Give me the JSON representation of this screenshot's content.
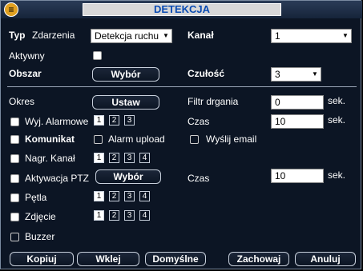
{
  "window": {
    "title": "DETEKCJA"
  },
  "labels": {
    "typ": "Typ",
    "zdarzenia": "Zdarzenia",
    "kanal": "Kanał",
    "aktywny": "Aktywny",
    "obszar": "Obszar",
    "czulosc": "Czułość",
    "okres": "Okres",
    "filtr": "Filtr drgania",
    "sek1": "sek.",
    "wyj": "Wyj. Alarmowe",
    "czas1": "Czas",
    "sek2": "sek.",
    "komunikat": "Komunikat",
    "alarm_upload": "Alarm upload",
    "wyslij_email": "Wyślij email",
    "nagr": "Nagr. Kanał",
    "aktywacja": "Aktywacja PTZ",
    "czas2": "Czas",
    "sek3": "sek.",
    "petla": "Pętla",
    "zdjecie": "Zdjęcie",
    "buzzer": "Buzzer"
  },
  "fields": {
    "typ_value": "Detekcja ruchu",
    "kanal_value": "1",
    "czulosc_value": "3",
    "filtr_value": "0",
    "czas1_value": "10",
    "czas2_value": "10"
  },
  "buttons": {
    "wybor1": "Wybór",
    "ustaw": "Ustaw",
    "wybor2": "Wybór",
    "kopiuj": "Kopiuj",
    "wklej": "Wklej",
    "domyslne": "Domyślne",
    "zachowaj": "Zachowaj",
    "anuluj": "Anuluj"
  },
  "numbers": {
    "n1": "1",
    "n2": "2",
    "n3": "3",
    "n4": "4"
  },
  "icons": {
    "arrow": "▼",
    "logo": "≡"
  }
}
